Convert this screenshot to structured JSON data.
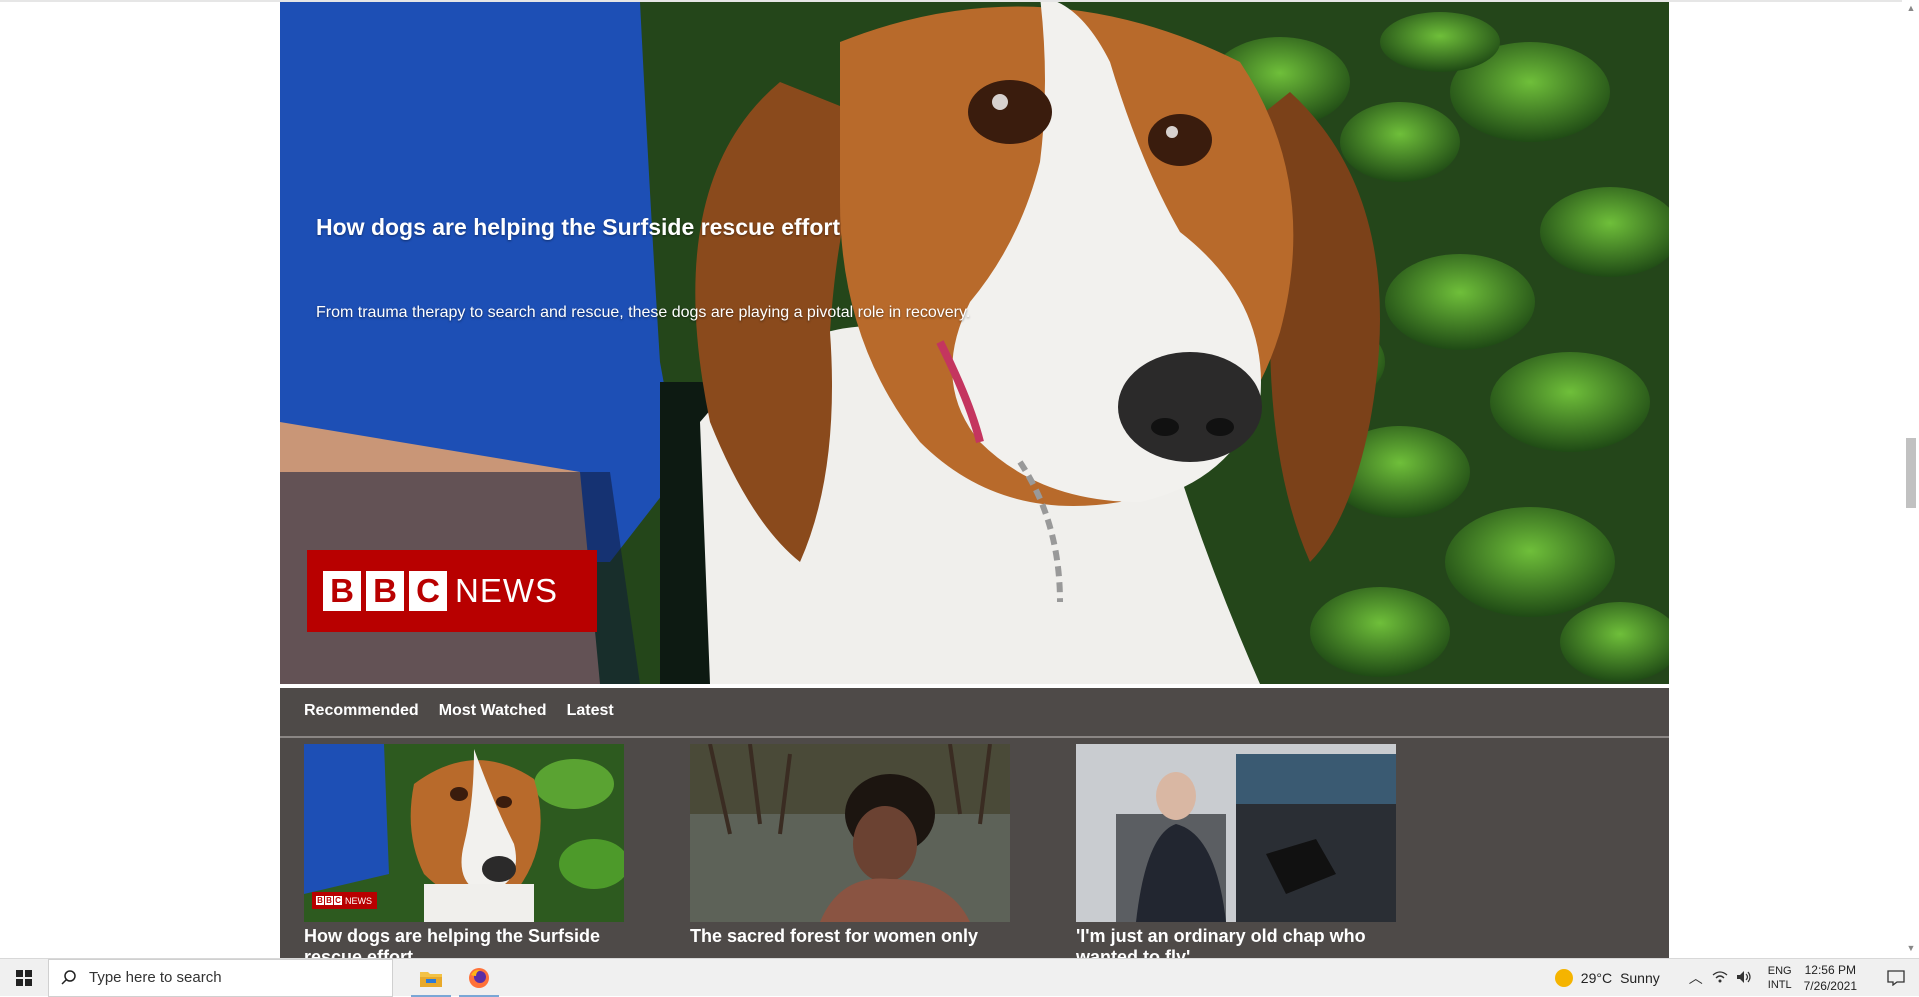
{
  "hero": {
    "title": "How dogs are helping the Surfside rescue effort",
    "description": "From trauma therapy to search and rescue, these dogs are playing a pivotal role in recovery.",
    "logo": {
      "block1": "B",
      "block2": "B",
      "block3": "C",
      "word": "NEWS"
    }
  },
  "tabs": [
    "Recommended",
    "Most Watched",
    "Latest"
  ],
  "cards": [
    {
      "title": "How dogs are helping the Surfside rescue effort",
      "thumb": "beagle"
    },
    {
      "title": "The sacred forest for women only",
      "thumb": "forest-woman"
    },
    {
      "title": "'I'm just an ordinary old chap who wanted to fly'",
      "thumb": "cockpit"
    }
  ],
  "mini_logo": {
    "block1": "B",
    "block2": "B",
    "block3": "C",
    "word": "NEWS"
  },
  "taskbar": {
    "search_placeholder": "Type here to search",
    "apps": [
      "file-explorer-icon",
      "firefox-icon"
    ],
    "weather_temp": "29°C",
    "weather_text": "Sunny",
    "lang_top": "ENG",
    "lang_bottom": "INTL",
    "time": "12:56 PM",
    "date": "7/26/2021"
  }
}
